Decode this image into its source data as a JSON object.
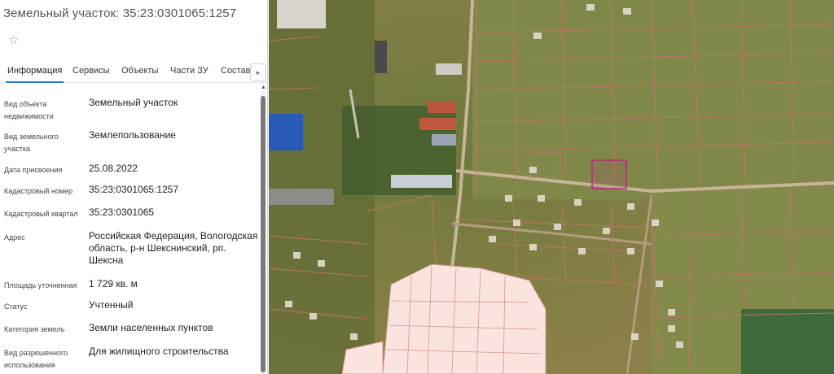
{
  "panel": {
    "title": "Земельный участок: 35:23:0301065:1257",
    "star": "☆",
    "tabs": [
      "Информация",
      "Сервисы",
      "Объекты",
      "Части ЗУ",
      "Состав"
    ],
    "tab_arrow": "▸"
  },
  "info": {
    "object_type_label": "Вид объекта недвижимости",
    "object_type": "Земельный участок",
    "land_type_label": "Вид земельного участка",
    "land_type": "Землепользование",
    "date_label": "Дата присвоения",
    "date": "25.08.2022",
    "cadastral_number_label": "Кадастровый номер",
    "cadastral_number": "35:23:0301065:1257",
    "cadastral_quarter_label": "Кадастровый квартал",
    "cadastral_quarter": "35:23:0301065",
    "address_label": "Адрес",
    "address": "Российская Федерация, Вологодская область, р-н Шекснинский, рп. Шексна",
    "area_label": "Площадь уточненная",
    "area": "1 729 кв. м",
    "status_label": "Статус",
    "status": "Учтенный",
    "category_label": "Категория земель",
    "category": "Земли населенных пунктов",
    "permitted_use_label": "Вид разрешенного использования",
    "permitted_use": "Для жилищного строительства"
  },
  "colors": {
    "accent": "#2a7bd4",
    "parcel_border": "#c9746a",
    "selected_parcel": "#b0307a"
  }
}
